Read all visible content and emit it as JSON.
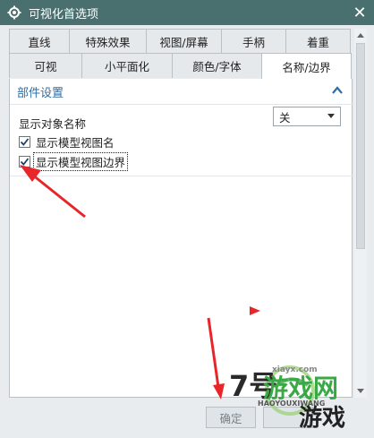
{
  "window": {
    "title": "可视化首选项",
    "close_label": "✕"
  },
  "tabs": {
    "row1": [
      "直线",
      "特殊效果",
      "视图/屏幕",
      "手柄",
      "着重"
    ],
    "row2": [
      "可视",
      "小平面化",
      "颜色/字体",
      "名称/边界"
    ],
    "active": "名称/边界"
  },
  "section": {
    "title": "部件设置"
  },
  "fields": {
    "show_object_name_label": "显示对象名称",
    "show_object_name_value": "关"
  },
  "checkboxes": {
    "show_model_view_name": {
      "label": "显示模型视图名",
      "checked": true
    },
    "show_model_view_border": {
      "label": "显示模型视图边界",
      "checked": true
    }
  },
  "buttons": {
    "ok_label": "确定"
  },
  "watermark": {
    "number": "7号",
    "brand_cn": "游戏网",
    "brand_cn2": "游戏",
    "domain": "xiayx.com",
    "pinyin": "HAOYOUXIWANG"
  },
  "colors": {
    "titlebar": "#4a6f6f",
    "section_title": "#2e6ea6",
    "annotation_arrow": "#e8262a"
  },
  "icons": [
    "gear-icon",
    "close-icon",
    "collapse-chevron-up-icon",
    "checkmark-icon",
    "scroll-up-arrow-icon",
    "scroll-down-arrow-icon"
  ]
}
